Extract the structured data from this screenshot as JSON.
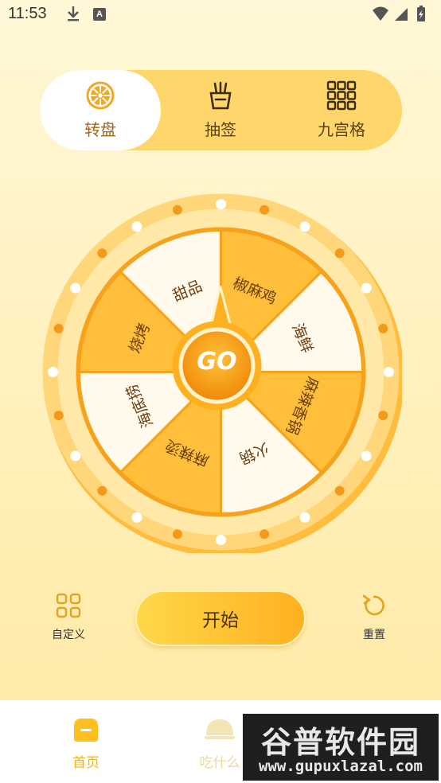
{
  "status_bar": {
    "time": "11:53",
    "a_badge": "A"
  },
  "tabs": [
    {
      "label": "转盘",
      "icon": "wheel-icon",
      "active": true
    },
    {
      "label": "抽签",
      "icon": "lottery-sticks-icon",
      "active": false
    },
    {
      "label": "九宫格",
      "icon": "grid-nine-icon",
      "active": false
    }
  ],
  "wheel": {
    "segments": [
      {
        "label": "椒麻鸡",
        "color": "#ffbf3a"
      },
      {
        "label": "海鲜",
        "color": "#fffaec"
      },
      {
        "label": "麻辣香锅",
        "color": "#ffbf3a"
      },
      {
        "label": "火锅",
        "color": "#fffaec"
      },
      {
        "label": "麻辣烫",
        "color": "#ffbf3a"
      },
      {
        "label": "海底捞",
        "color": "#fffaec"
      },
      {
        "label": "烧烤",
        "color": "#ffbf3a"
      },
      {
        "label": "甜品",
        "color": "#fffaec"
      }
    ],
    "go_label": "GO"
  },
  "controls": {
    "custom_label": "自定义",
    "start_label": "开始",
    "reset_label": "重置"
  },
  "bottom_nav": {
    "home_label": "首页",
    "eat_label": "吃什么"
  },
  "watermark": {
    "title": "谷普软件园",
    "url": "www.gupuxlazal.com"
  },
  "colors": {
    "accent": "#ffbf3a",
    "home_active": "#f0b515"
  }
}
